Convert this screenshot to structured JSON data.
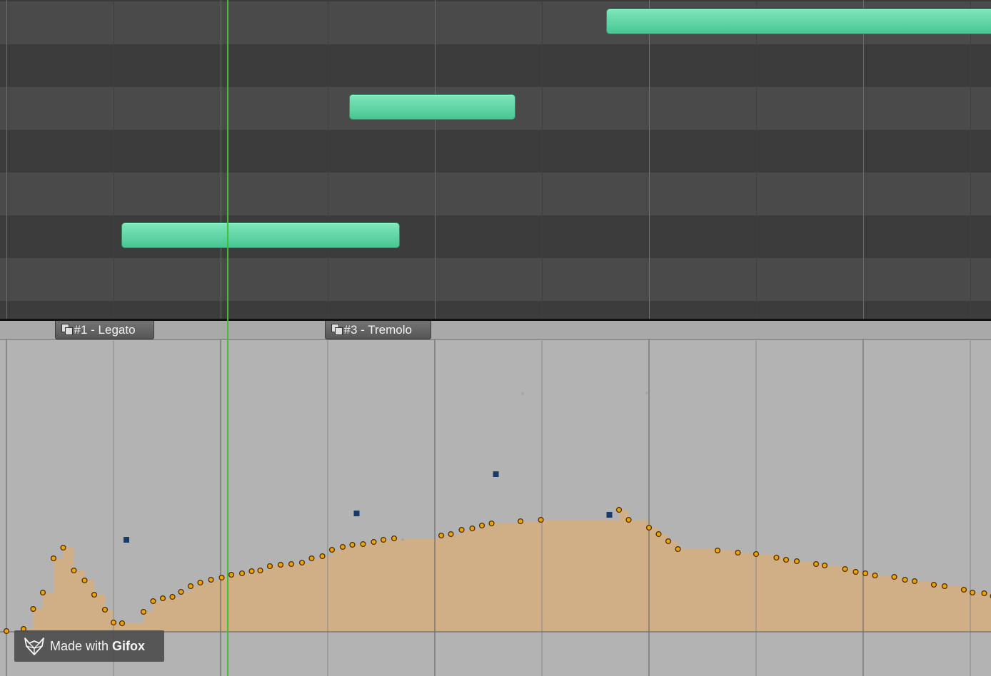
{
  "app": {
    "accent_color": "#3cc22a",
    "note_color": "#5ed8a6"
  },
  "piano_roll": {
    "row_shading": [
      "light",
      "dark",
      "light",
      "dark",
      "light",
      "dark",
      "light",
      "dark"
    ],
    "notes": [
      {
        "start_beat": 5.6,
        "length_beats": 11.8,
        "row": 0
      },
      {
        "start_beat": 3.2,
        "length_beats": 1.55,
        "row": 2
      },
      {
        "start_beat": 1.07,
        "length_beats": 2.6,
        "row": 5
      }
    ]
  },
  "markers": [
    {
      "number": "#1",
      "name": " - Legato",
      "icon": "articulation-flag-icon",
      "beat": 0.45
    },
    {
      "number": "#3",
      "name": " - Tremolo",
      "icon": "articulation-flag-icon",
      "beat": 2.97
    }
  ],
  "playhead": {
    "beat": 2.06
  },
  "cc_lane": {
    "fill_color": "#d1af86",
    "point_color": "#f0a400",
    "handle_color": "#1a3a6a",
    "points": [
      [
        0.0,
        1
      ],
      [
        0.16,
        4
      ],
      [
        0.25,
        32
      ],
      [
        0.34,
        55
      ],
      [
        0.44,
        103
      ],
      [
        0.53,
        118
      ],
      [
        0.63,
        86
      ],
      [
        0.73,
        72
      ],
      [
        0.82,
        52
      ],
      [
        0.92,
        31
      ],
      [
        1.0,
        13
      ],
      [
        1.08,
        12
      ],
      [
        1.28,
        28
      ],
      [
        1.37,
        43
      ],
      [
        1.46,
        47
      ],
      [
        1.55,
        49
      ],
      [
        1.63,
        56
      ],
      [
        1.72,
        64
      ],
      [
        1.81,
        69
      ],
      [
        1.91,
        73
      ],
      [
        2.01,
        76
      ],
      [
        2.1,
        80
      ],
      [
        2.2,
        82
      ],
      [
        2.29,
        85
      ],
      [
        2.37,
        86
      ],
      [
        2.46,
        92
      ],
      [
        2.56,
        94
      ],
      [
        2.66,
        95
      ],
      [
        2.76,
        97
      ],
      [
        2.85,
        103
      ],
      [
        2.95,
        106
      ],
      [
        3.04,
        115
      ],
      [
        3.14,
        119
      ],
      [
        3.23,
        122
      ],
      [
        3.33,
        123
      ],
      [
        3.43,
        126
      ],
      [
        3.52,
        129
      ],
      [
        3.62,
        131
      ],
      [
        4.06,
        135
      ],
      [
        4.15,
        137
      ],
      [
        4.25,
        143
      ],
      [
        4.35,
        145
      ],
      [
        4.44,
        149
      ],
      [
        4.53,
        152
      ],
      [
        4.8,
        155
      ],
      [
        4.99,
        157
      ],
      [
        5.72,
        171
      ],
      [
        5.81,
        157
      ],
      [
        6.0,
        146
      ],
      [
        6.09,
        137
      ],
      [
        6.18,
        127
      ],
      [
        6.27,
        116
      ],
      [
        6.64,
        114
      ],
      [
        6.83,
        111
      ],
      [
        7.0,
        109
      ],
      [
        7.19,
        104
      ],
      [
        7.28,
        101
      ],
      [
        7.38,
        99
      ],
      [
        7.56,
        95
      ],
      [
        7.64,
        93
      ],
      [
        7.83,
        88
      ],
      [
        7.93,
        84
      ],
      [
        8.02,
        82
      ],
      [
        8.11,
        79
      ],
      [
        8.29,
        77
      ],
      [
        8.39,
        73
      ],
      [
        8.48,
        71
      ],
      [
        8.66,
        66
      ],
      [
        8.76,
        64
      ],
      [
        8.94,
        59
      ],
      [
        9.02,
        55
      ],
      [
        9.13,
        54
      ],
      [
        9.21,
        50
      ]
    ],
    "handles": [
      [
        1.12,
        129
      ],
      [
        3.27,
        166
      ],
      [
        4.57,
        221
      ],
      [
        5.63,
        164
      ]
    ],
    "guides": [
      [
        3.7,
        129
      ],
      [
        4.82,
        334
      ],
      [
        5.98,
        335
      ]
    ]
  },
  "watermark": {
    "prefix": "Made with ",
    "brand": "Gifox",
    "icon": "gifox-fox-icon"
  }
}
